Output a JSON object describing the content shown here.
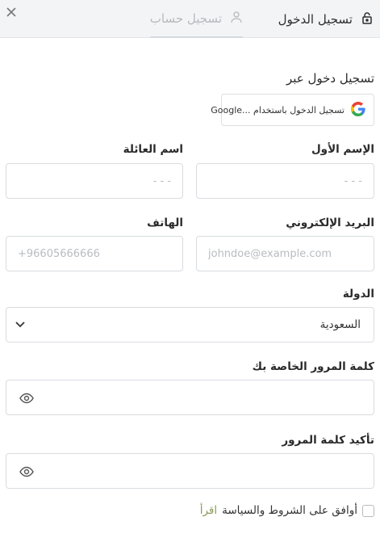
{
  "tabs": {
    "login_label": "تسجيل الدخول",
    "register_label": "تسجيل حساب"
  },
  "social": {
    "heading": "تسجيل دخول عبر",
    "google_label": "تسجيل الدخول باستخدام ...Google"
  },
  "form": {
    "first_name": {
      "label": "الإسم الأول",
      "placeholder": "- - -"
    },
    "last_name": {
      "label": "اسم العائلة",
      "placeholder": "- - -"
    },
    "email": {
      "label": "البريد الإلكتروني",
      "placeholder": "johndoe@example.com"
    },
    "phone": {
      "label": "الهاتف",
      "placeholder": "+96605666666"
    },
    "country": {
      "label": "الدولة",
      "selected": "السعودية"
    },
    "password": {
      "label": "كلمة المرور الخاصة بك"
    },
    "confirm_password": {
      "label": "تأكيد كلمة المرور"
    },
    "terms": {
      "text": "أوافق على الشروط والسياسة",
      "link": "اقرأ"
    }
  },
  "colors": {
    "accent_link": "#8a9a5b",
    "header_bg": "#f3f4f6"
  }
}
